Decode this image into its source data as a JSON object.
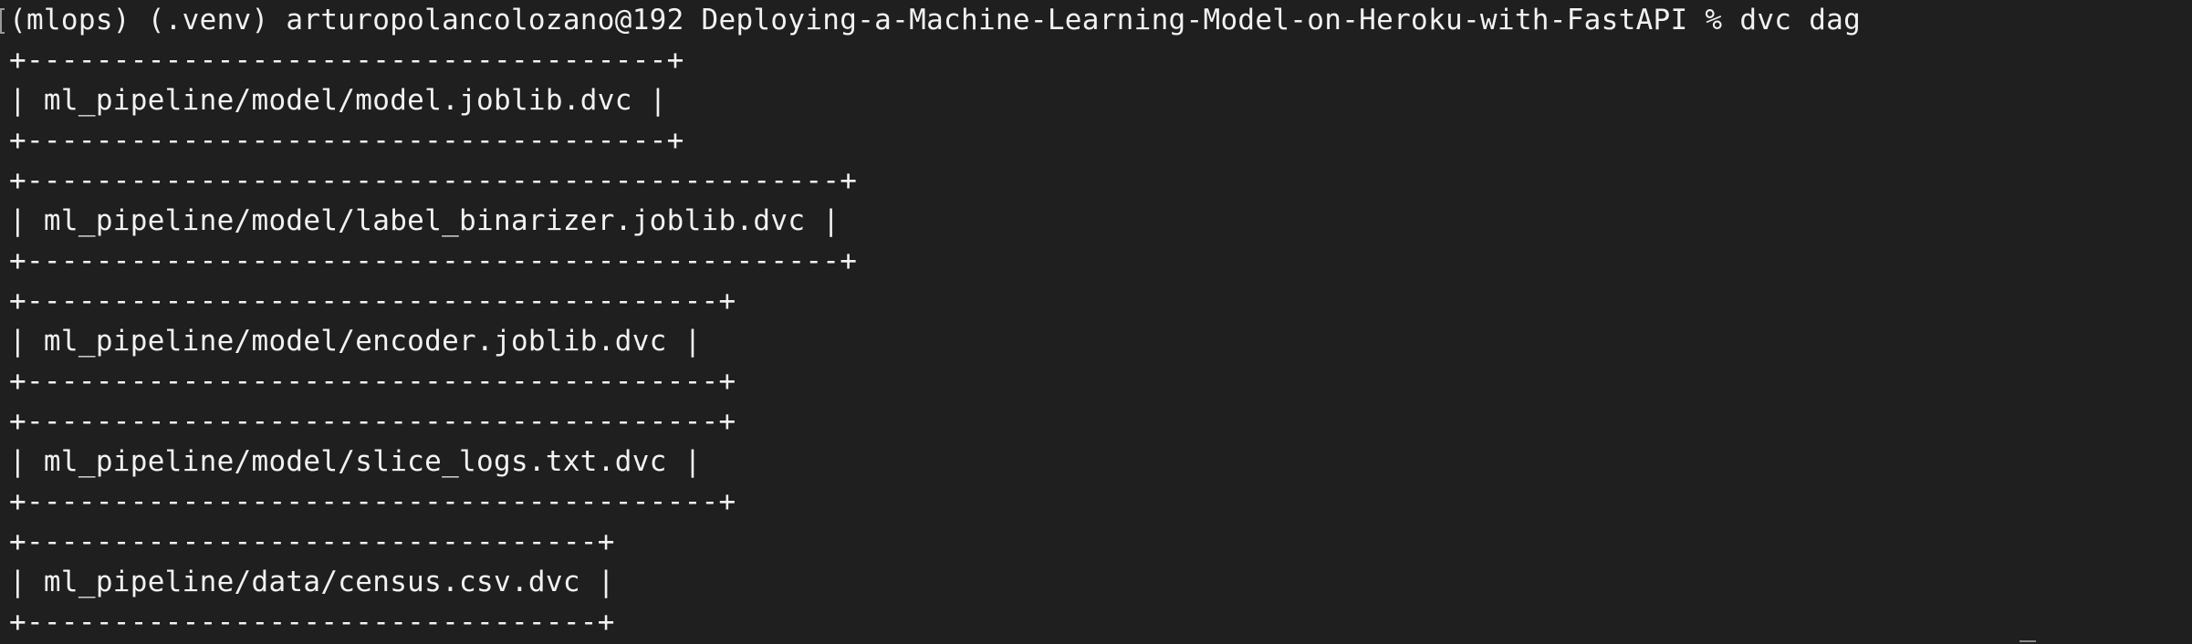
{
  "terminal": {
    "prompt_line": "(mlops) (.venv) arturopolancolozano@192 Deploying-a-Machine-Learning-Model-on-Heroku-with-FastAPI % dvc dag",
    "boxes": [
      {
        "top": "+-------------------------------------+",
        "label": "| ml_pipeline/model/model.joblib.dvc |",
        "bottom": "+-------------------------------------+"
      },
      {
        "top": "+-----------------------------------------------+",
        "label": "| ml_pipeline/model/label_binarizer.joblib.dvc |",
        "bottom": "+-----------------------------------------------+"
      },
      {
        "top": "+----------------------------------------+",
        "label": "| ml_pipeline/model/encoder.joblib.dvc |",
        "bottom": "+----------------------------------------+"
      },
      {
        "top": "+----------------------------------------+",
        "label": "| ml_pipeline/model/slice_logs.txt.dvc |",
        "bottom": "+----------------------------------------+"
      },
      {
        "top": "+---------------------------------+",
        "label": "| ml_pipeline/data/census.csv.dvc |",
        "bottom": "+---------------------------------+"
      }
    ]
  }
}
